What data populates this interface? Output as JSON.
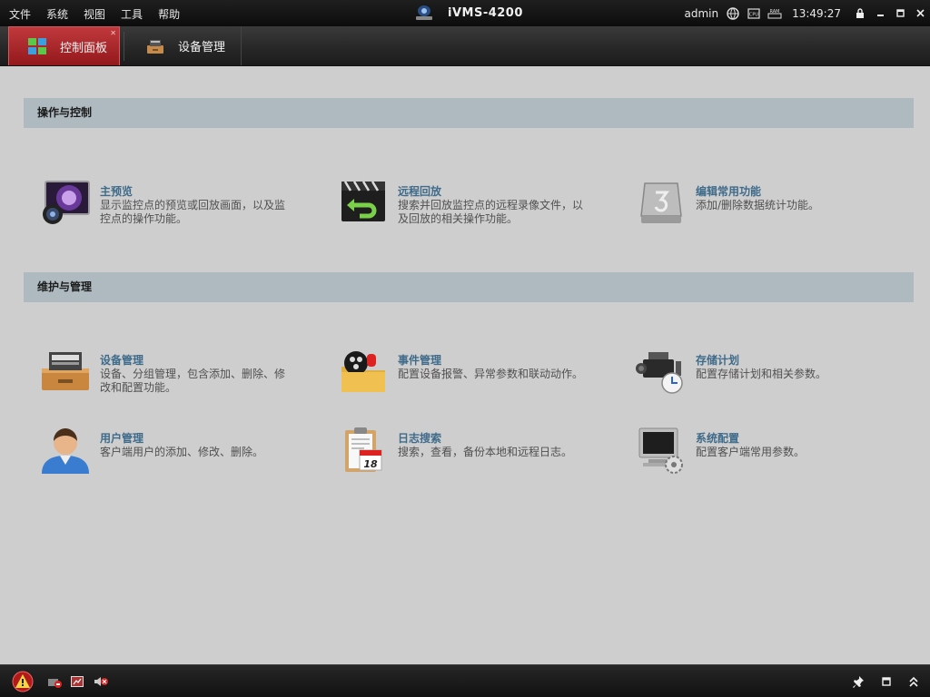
{
  "menu": [
    "文件",
    "系统",
    "视图",
    "工具",
    "帮助"
  ],
  "app": {
    "title": "iVMS-4200"
  },
  "status": {
    "user": "admin",
    "time": "13:49:27",
    "icons": [
      "network-icon",
      "cpu-icon",
      "ram-icon"
    ],
    "cpu_label": "CPU",
    "ram_label": "RAM"
  },
  "tabs": [
    {
      "label": "控制面板",
      "icon": "control-panel-icon",
      "active": true
    },
    {
      "label": "设备管理",
      "icon": "device-management-icon",
      "active": false
    }
  ],
  "sections": [
    {
      "title": "操作与控制",
      "items": [
        {
          "title": "主预览",
          "desc": "显示监控点的预览或回放画面，以及监控点的操作功能。",
          "icon": "live-view-icon"
        },
        {
          "title": "远程回放",
          "desc": "搜索并回放监控点的远程录像文件，以及回放的相关操作功能。",
          "icon": "remote-playback-icon"
        },
        {
          "title": "编辑常用功能",
          "desc": "添加/删除数据统计功能。",
          "icon": "edit-shortcut-icon"
        }
      ]
    },
    {
      "title": "维护与管理",
      "items": [
        {
          "title": "设备管理",
          "desc": "设备、分组管理，包含添加、删除、修改和配置功能。",
          "icon": "device-management-icon"
        },
        {
          "title": "事件管理",
          "desc": "配置设备报警、异常参数和联动动作。",
          "icon": "event-management-icon"
        },
        {
          "title": "存储计划",
          "desc": "配置存储计划和相关参数。",
          "icon": "storage-schedule-icon"
        },
        {
          "title": "用户管理",
          "desc": "客户端用户的添加、修改、删除。",
          "icon": "user-management-icon"
        },
        {
          "title": "日志搜索",
          "desc": "搜索，查看，备份本地和远程日志。",
          "icon": "log-search-icon"
        },
        {
          "title": "系统配置",
          "desc": "配置客户端常用参数。",
          "icon": "system-config-icon"
        }
      ]
    }
  ],
  "log_icon_number": "18",
  "colors": {
    "accent_tab": "#b02a2e",
    "section_header": "#aebabf",
    "item_title": "#3f6b8a",
    "background": "#cecece"
  }
}
